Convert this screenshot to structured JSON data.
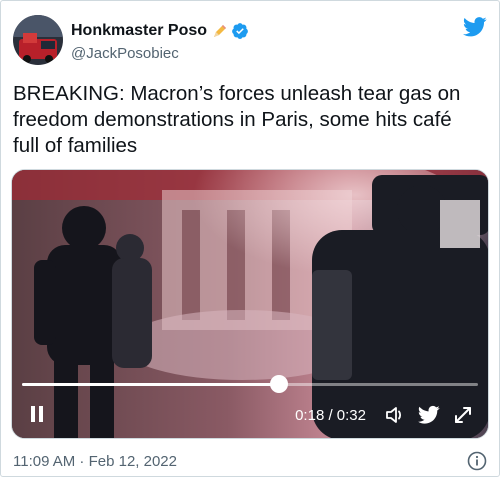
{
  "tweet": {
    "display_name": "Honkmaster Poso",
    "handle": "@JackPosobiec",
    "text": "BREAKING: Macron’s forces unleash tear gas on\nfreedom demonstrations in Paris, some hits café\nfull of families",
    "timestamp": "11:09 AM · Feb 12, 2022"
  },
  "icons": {
    "emoji": "pencil-crayon-icon",
    "verified": "verified-badge-icon",
    "brand": "twitter-bird-icon",
    "info": "info-icon"
  },
  "video": {
    "time_display": "0:18 / 0:32",
    "elapsed_seconds": 18,
    "duration_seconds": 32,
    "controls": [
      "pause-icon",
      "volume-icon",
      "twitter-bird-icon",
      "fullscreen-icon"
    ]
  },
  "colors": {
    "brand_blue": "#1d9bf0",
    "text_primary": "#0f1419",
    "text_secondary": "#536471"
  }
}
